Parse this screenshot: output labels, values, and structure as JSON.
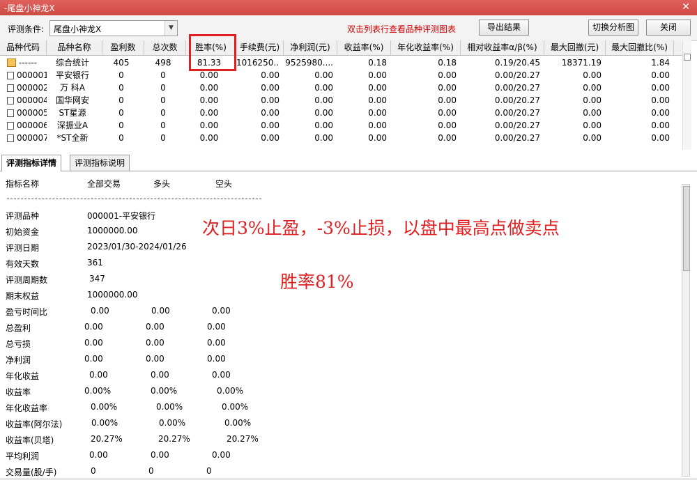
{
  "window": {
    "title": "-尾盘小神龙X"
  },
  "toolbar": {
    "condition_label": "评测条件:",
    "condition_value": "尾盘小神龙X",
    "hint": "双击列表行查看品种评测图表",
    "export_label": "导出结果",
    "switch_label": "切换分析图",
    "close_label": "关闭"
  },
  "table": {
    "headers": [
      "品种代码",
      "品种名称",
      "盈利数",
      "总次数",
      "胜率(%)",
      "手续费(元)",
      "净利润(元)",
      "收益率(%)",
      "年化收益率(%)",
      "相对收益率α/β(%)",
      "最大回撤(元)",
      "最大回撤比(%)"
    ],
    "rows": [
      [
        "------",
        "综合统计",
        "405",
        "498",
        "81.33",
        "1016250....",
        "9525980....",
        "0.18",
        "0.18",
        "0.19/20.45",
        "18371.19",
        "1.84"
      ],
      [
        "000001",
        "平安银行",
        "0",
        "0",
        "0.00",
        "0.00",
        "0.00",
        "0.00",
        "0.00",
        "0.00/20.27",
        "0.00",
        "0.00"
      ],
      [
        "000002",
        "万 科A",
        "0",
        "0",
        "0.00",
        "0.00",
        "0.00",
        "0.00",
        "0.00",
        "0.00/20.27",
        "0.00",
        "0.00"
      ],
      [
        "000004",
        "国华网安",
        "0",
        "0",
        "0.00",
        "0.00",
        "0.00",
        "0.00",
        "0.00",
        "0.00/20.27",
        "0.00",
        "0.00"
      ],
      [
        "000005",
        "ST星源",
        "0",
        "0",
        "0.00",
        "0.00",
        "0.00",
        "0.00",
        "0.00",
        "0.00/20.27",
        "0.00",
        "0.00"
      ],
      [
        "000006",
        "深振业A",
        "0",
        "0",
        "0.00",
        "0.00",
        "0.00",
        "0.00",
        "0.00",
        "0.00/20.27",
        "0.00",
        "0.00"
      ],
      [
        "000007",
        "*ST全新",
        "0",
        "0",
        "0.00",
        "0.00",
        "0.00",
        "0.00",
        "0.00",
        "0.00/20.27",
        "0.00",
        "0.00"
      ]
    ]
  },
  "tabs": [
    "评测指标详情",
    "评测指标说明"
  ],
  "detail": {
    "headers": [
      "指标名称",
      "全部交易",
      "多头",
      "空头"
    ],
    "info": [
      {
        "label": "评测品种",
        "value": "000001-平安银行"
      },
      {
        "label": "初始资金",
        "value": "1000000.00"
      },
      {
        "label": "评测日期",
        "value": "2023/01/30-2024/01/26"
      },
      {
        "label": "有效天数",
        "value": "361"
      },
      {
        "label": "评测周期数",
        "value": "347"
      },
      {
        "label": "期末权益",
        "value": "1000000.00"
      }
    ],
    "metrics": [
      {
        "label": "盈亏时间比",
        "all": "0.00",
        "long": "0.00",
        "short": "0.00"
      },
      {
        "label": "总盈利",
        "all": "0.00",
        "long": "0.00",
        "short": "0.00"
      },
      {
        "label": "总亏损",
        "all": "0.00",
        "long": "0.00",
        "short": "0.00"
      },
      {
        "label": "净利润",
        "all": "0.00",
        "long": "0.00",
        "short": "0.00"
      },
      {
        "label": "年化收益",
        "all": "0.00",
        "long": "0.00",
        "short": "0.00"
      },
      {
        "label": "收益率",
        "all": "0.00%",
        "long": "0.00%",
        "short": "0.00%"
      },
      {
        "label": "年化收益率",
        "all": "0.00%",
        "long": "0.00%",
        "short": "0.00%"
      },
      {
        "label": "收益率(阿尔法)",
        "all": "0.00%",
        "long": "0.00%",
        "short": "0.00%"
      },
      {
        "label": "收益率(贝塔)",
        "all": "20.27%",
        "long": "20.27%",
        "short": "20.27%"
      },
      {
        "label": "平均利润",
        "all": "0.00",
        "long": "0.00",
        "short": "0.00"
      },
      {
        "label": "交易量(股/手)",
        "all": "0",
        "long": "0",
        "short": "0"
      }
    ]
  },
  "annotations": {
    "line1": "次日3%止盈，-3%止损，以盘中最高点做卖点",
    "line2": "胜率81%"
  },
  "colors": {
    "title_bar": "#d9534f",
    "hint": "#d00000",
    "annotation": "#e02020"
  }
}
